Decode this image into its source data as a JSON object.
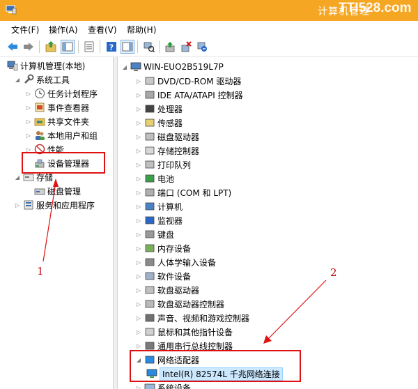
{
  "window": {
    "title": "计算机管理",
    "watermark": "TTI528.com"
  },
  "menu": [
    "文件(F)",
    "操作(A)",
    "查看(V)",
    "帮助(H)"
  ],
  "toolbar": [
    "back-icon",
    "forward-icon",
    "up-folder-icon",
    "show-tree-icon",
    "properties-icon",
    "help-icon",
    "console-icon",
    "scan-hardware-icon",
    "update-driver-icon",
    "uninstall-icon",
    "disable-icon"
  ],
  "left_tree": {
    "root": "计算机管理(本地)",
    "system_tools": "系统工具",
    "items": [
      "任务计划程序",
      "事件查看器",
      "共享文件夹",
      "本地用户和组",
      "性能",
      "设备管理器"
    ],
    "storage": "存储",
    "disk_mgmt": "磁盘管理",
    "services": "服务和应用程序"
  },
  "right_tree": {
    "root": "WIN-EUO2B519L7P",
    "categories": [
      "DVD/CD-ROM 驱动器",
      "IDE ATA/ATAPI 控制器",
      "处理器",
      "传感器",
      "磁盘驱动器",
      "存储控制器",
      "打印队列",
      "电池",
      "端口 (COM 和 LPT)",
      "计算机",
      "监视器",
      "键盘",
      "内存设备",
      "人体学输入设备",
      "软件设备",
      "软盘驱动器",
      "软盘驱动器控制器",
      "声音、视频和游戏控制器",
      "鼠标和其他指针设备",
      "通用串行总线控制器",
      "网络适配器"
    ],
    "network_child": "Intel(R) 82574L 千兆网络连接",
    "last_partial": "系统设备"
  },
  "annotations": {
    "one": "1",
    "two": "2",
    "color": "#e01010"
  }
}
